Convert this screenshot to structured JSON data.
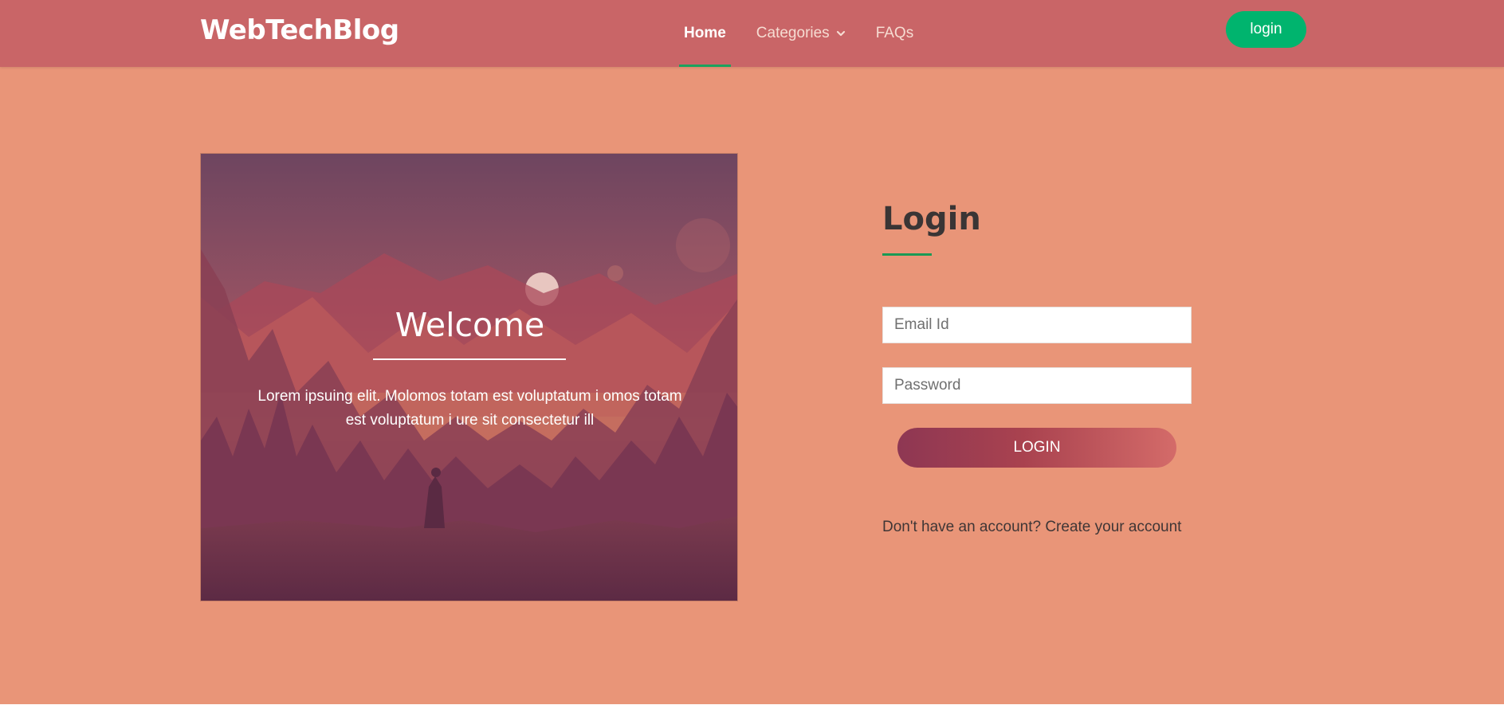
{
  "header": {
    "brand": "WebTechBlog",
    "nav": [
      {
        "label": "Home",
        "active": true
      },
      {
        "label": "Categories",
        "has_dropdown": true
      },
      {
        "label": "FAQs"
      }
    ],
    "login_label": "login"
  },
  "hero": {
    "title": "Welcome",
    "text": "Lorem ipsuing elit. Molomos totam est voluptatum i omos totam est voluptatum i ure sit consectetur ill"
  },
  "login_form": {
    "title": "Login",
    "email_placeholder": "Email Id",
    "password_placeholder": "Password",
    "submit_label": "LOGIN",
    "signup_prompt": "Don't have an account?",
    "signup_link": "Create your account"
  },
  "colors": {
    "page_bg": "#e99578",
    "header_bg": "#c96567",
    "accent_green": "#00b46e",
    "text_dark": "#3a3535"
  },
  "icons": {
    "categories_dropdown": "chevron-down-icon"
  }
}
